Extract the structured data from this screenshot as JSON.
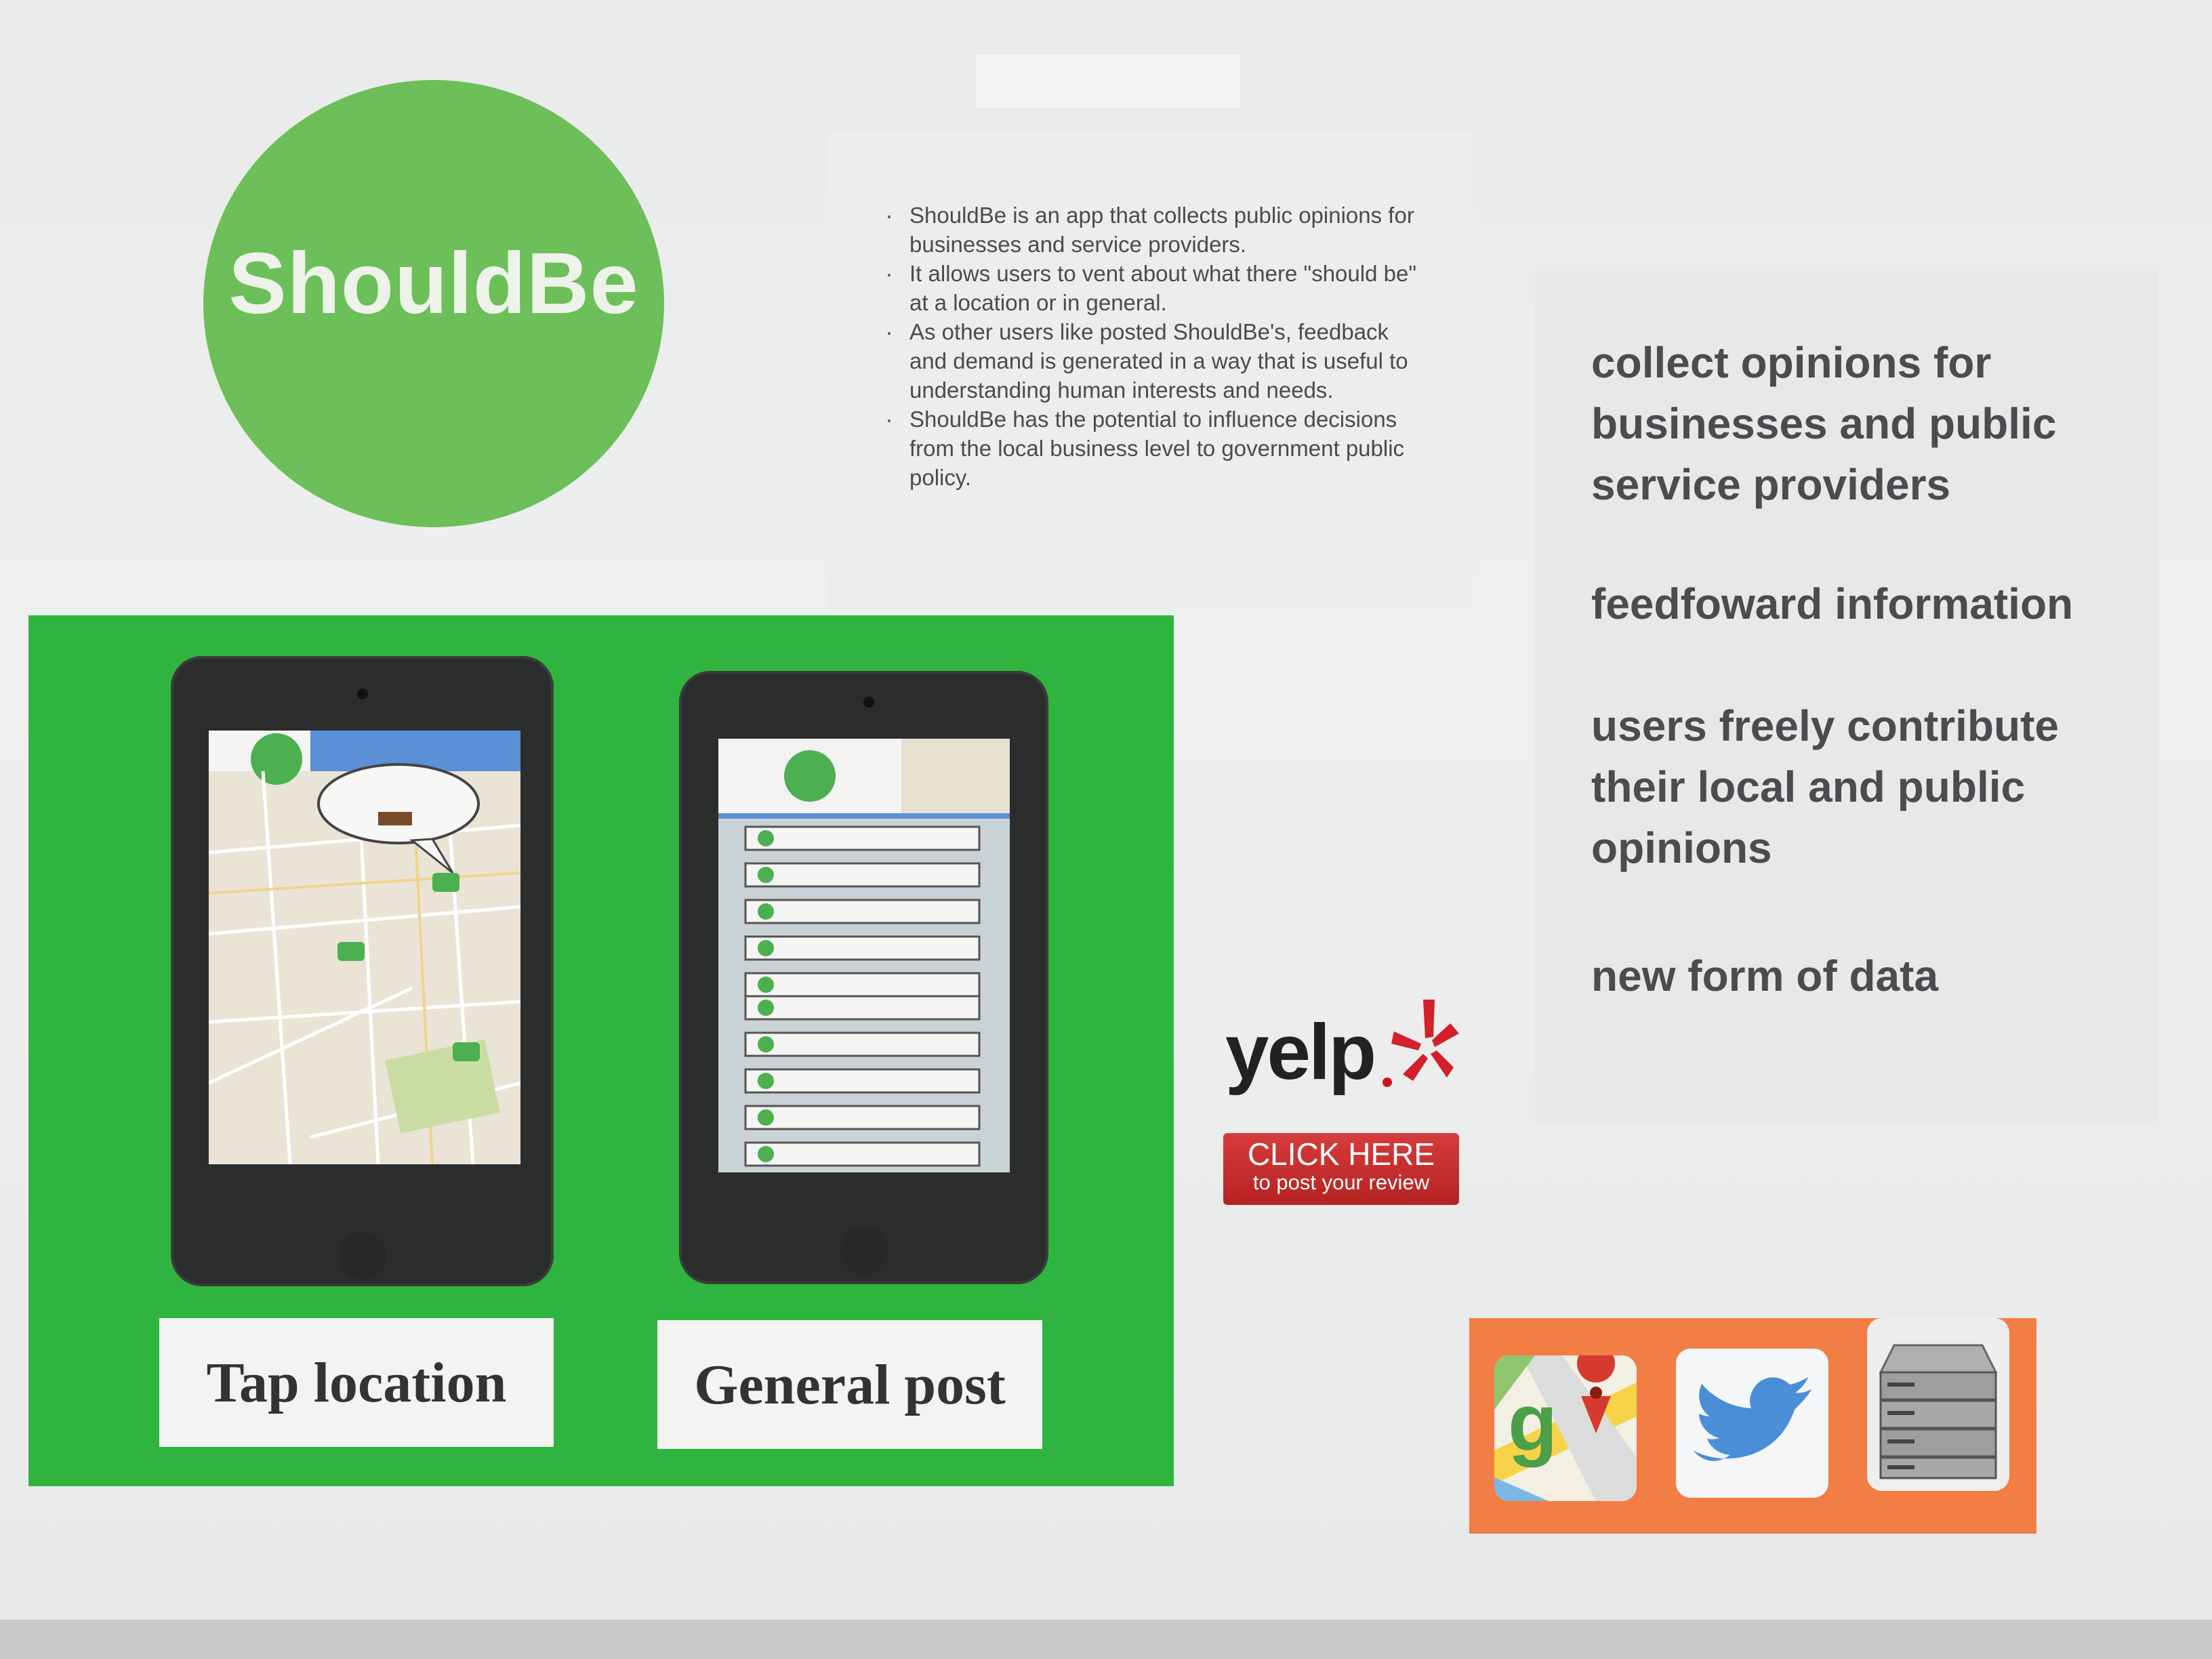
{
  "logo": {
    "text": "ShouldBe",
    "color": "#6cbf59"
  },
  "description": {
    "items": [
      "ShouldBe is an app that collects public opinions for businesses and service providers.",
      "It allows users to vent about what there \"should be\" at a location or in general.",
      "As other users like posted ShouldBe's, feedback and demand is generated in a way that is useful to understanding human interests and needs.",
      "ShouldBe has the potential to influence decisions from the local business level to government public policy."
    ]
  },
  "key_points": [
    "collect opinions for businesses and public service providers",
    "feedfoward information",
    "users freely contribute their local and public opinions",
    "new form of data"
  ],
  "tablets": {
    "left_label": "Tap location",
    "right_label": "General post",
    "panel_color": "#2fb53f"
  },
  "yelp": {
    "logo": "yelp",
    "button_main": "CLICK HERE",
    "button_sub": "to post your review",
    "brand_color": "#c9141d"
  },
  "icons": [
    "google-maps-icon",
    "twitter-icon",
    "server-icon"
  ],
  "icon_strip_color": "#f27e45"
}
